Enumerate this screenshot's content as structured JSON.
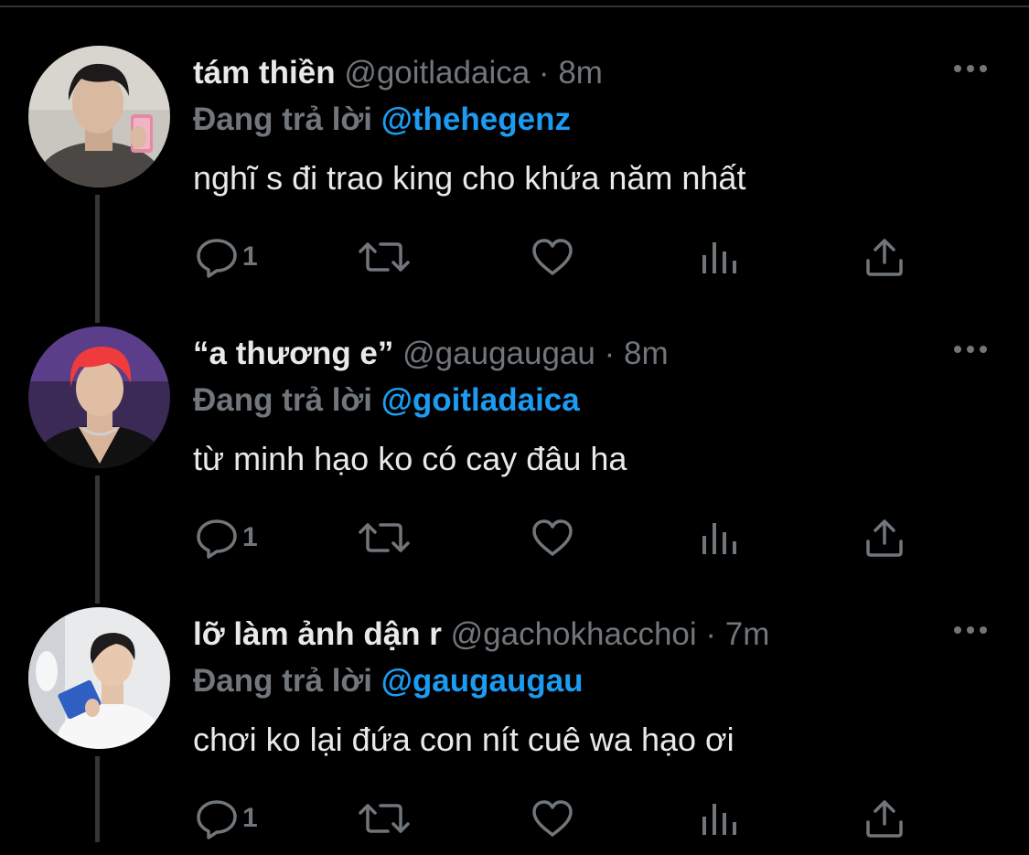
{
  "colors": {
    "background": "#000000",
    "text_primary": "#e7e9ea",
    "text_secondary": "#71767b",
    "mention": "#1d9bf0",
    "thread_line": "#333639"
  },
  "icons": {
    "reply": "reply-icon",
    "retweet": "retweet-icon",
    "like": "like-icon",
    "views": "views-icon",
    "share": "share-icon",
    "more": "more-icon"
  },
  "tweets": [
    {
      "name": "tám thiền",
      "handle": "@goitladaica",
      "separator": "·",
      "time": "8m",
      "replying_label": "Đang trả lời",
      "replying_to": "@thehegenz",
      "text": "nghĩ s đi trao king cho khứa năm nhất",
      "reply_count": "1"
    },
    {
      "name": "“a thương e”",
      "handle": "@gaugaugau",
      "separator": "·",
      "time": "8m",
      "replying_label": "Đang trả lời",
      "replying_to": "@goitladaica",
      "text": "từ minh hạo ko có cay đâu ha",
      "reply_count": "1"
    },
    {
      "name": "lỡ làm ảnh dận r",
      "handle": "@gachokhacchoi",
      "separator": "·",
      "time": "7m",
      "replying_label": "Đang trả lời",
      "replying_to": "@gaugaugau",
      "text": "chơi ko lại đứa con nít cuê wa hạo ơi",
      "reply_count": "1"
    }
  ]
}
